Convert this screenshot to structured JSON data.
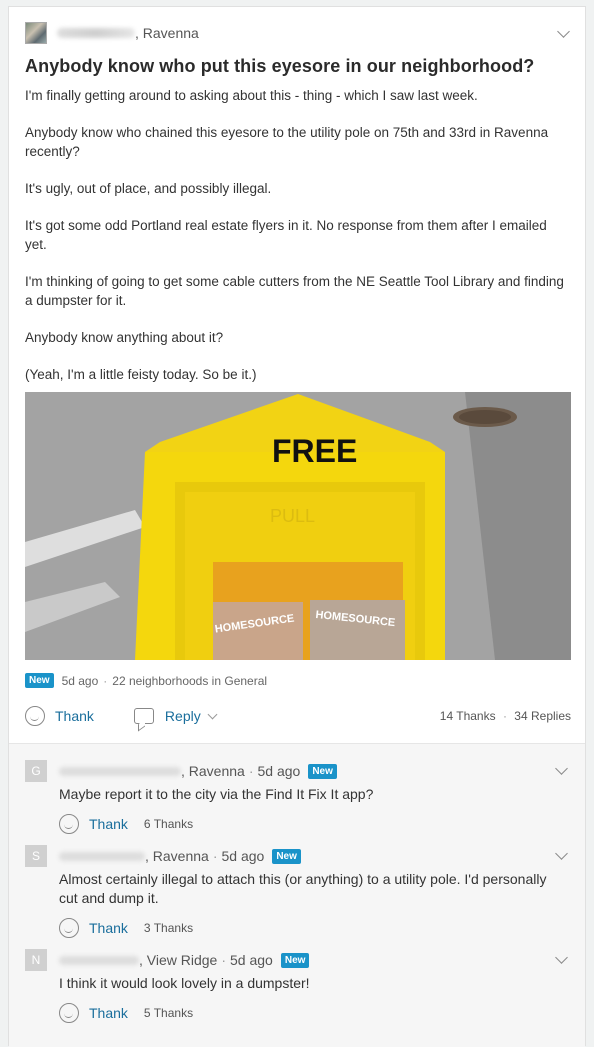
{
  "post": {
    "neighborhood": ", Ravenna",
    "title": "Anybody know who put this eyesore in our neighborhood?",
    "paragraphs": [
      "I'm finally getting around to asking about this - thing - which I saw last week.",
      "Anybody know who chained this eyesore to the utility pole on 75th and 33rd in Ravenna recently?",
      "It's ugly, out of place, and possibly illegal.",
      "It's got some odd Portland real estate flyers in it. No response from them after I emailed yet.",
      "I'm thinking of going to get some cable cutters from the NE Seattle Tool Library and finding a dumpster for it.",
      "Anybody know anything about it?",
      "(Yeah, I'm a little feisty today. So be it.)"
    ],
    "photo": {
      "box_sign": "FREE",
      "box_embossed": "PULL",
      "flyer_text": "HOMESOURCE"
    },
    "meta": {
      "badge": "New",
      "age": "5d ago",
      "separator": "·",
      "audience": "22 neighborhoods in General"
    },
    "actions": {
      "thank_label": "Thank",
      "reply_label": "Reply",
      "thanks_count": "14 Thanks",
      "separator": "·",
      "replies_count": "34 Replies"
    }
  },
  "replies": [
    {
      "initial": "G",
      "neighborhood": ", Ravenna",
      "age": "5d ago",
      "badge": "New",
      "text": "Maybe report it to the city via the Find It Fix It app?",
      "thank_label": "Thank",
      "thanks": "6 Thanks"
    },
    {
      "initial": "S",
      "neighborhood": ", Ravenna",
      "age": "5d ago",
      "badge": "New",
      "text": "Almost certainly illegal to attach this (or anything) to a utility pole. I'd personally cut and dump it.",
      "thank_label": "Thank",
      "thanks": "3 Thanks"
    },
    {
      "initial": "N",
      "neighborhood": ", View Ridge",
      "age": "5d ago",
      "badge": "New",
      "text": "I think it would look lovely in a dumpster!",
      "thank_label": "Thank",
      "thanks": "5 Thanks"
    }
  ],
  "colors": {
    "link": "#1a6e9c",
    "badge": "#1a93c9",
    "page_bg": "#f0f2f2"
  },
  "icons": {
    "menu": "chevron-down-icon",
    "thank": "smile-icon",
    "reply": "speech-bubble-icon"
  }
}
